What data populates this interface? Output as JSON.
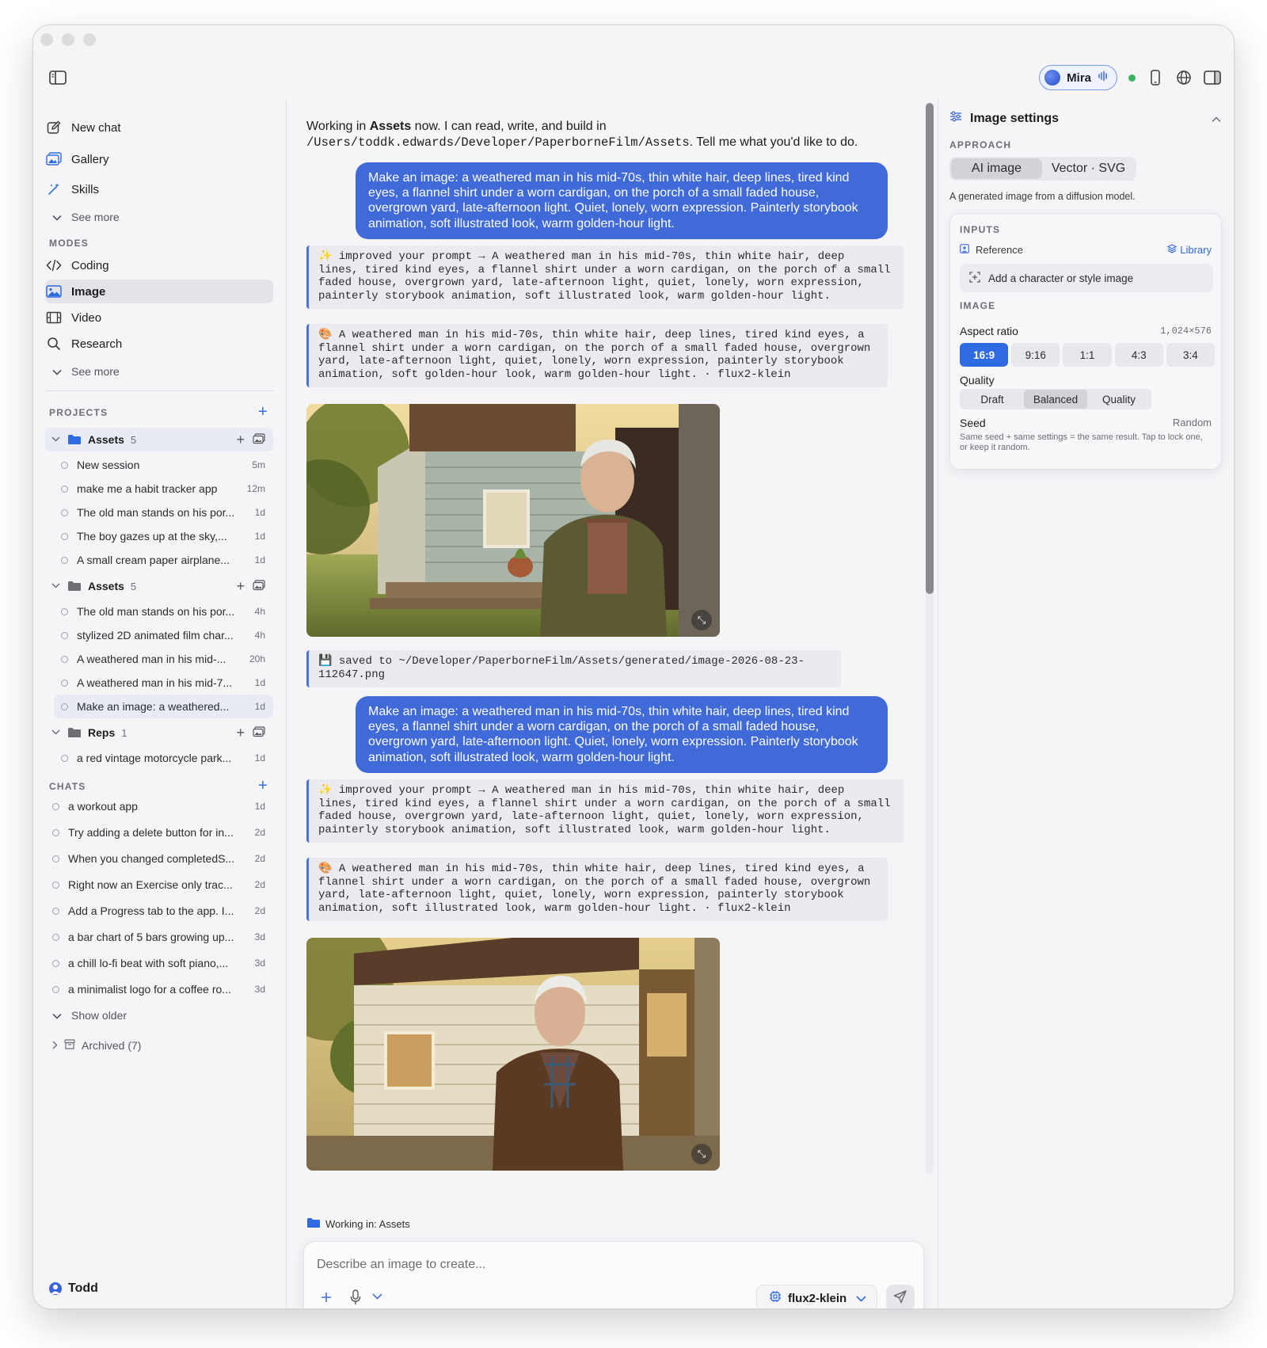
{
  "titlebar": {
    "assistant_name": "Mira"
  },
  "sidebar": {
    "nav": [
      {
        "label": "New chat",
        "icon": "compose-icon"
      },
      {
        "label": "Gallery",
        "icon": "gallery-icon"
      },
      {
        "label": "Skills",
        "icon": "magic-wand-icon"
      }
    ],
    "see_more_1": "See more",
    "modes_label": "MODES",
    "modes": [
      {
        "label": "Coding",
        "icon": "code-icon"
      },
      {
        "label": "Image",
        "icon": "image-icon"
      },
      {
        "label": "Video",
        "icon": "film-icon"
      },
      {
        "label": "Research",
        "icon": "search-icon"
      }
    ],
    "active_mode": "Image",
    "see_more_2": "See more",
    "projects_label": "PROJECTS",
    "projects": [
      {
        "name": "Assets",
        "count": "5",
        "sessions": [
          {
            "title": "New session",
            "age": "5m"
          },
          {
            "title": "make me a habit tracker app",
            "age": "12m"
          },
          {
            "title": "The old man stands on his por...",
            "age": "1d"
          },
          {
            "title": "The boy gazes up at the sky,...",
            "age": "1d"
          },
          {
            "title": "A small cream paper airplane...",
            "age": "1d"
          }
        ]
      },
      {
        "name": "Assets",
        "count": "5",
        "sessions": [
          {
            "title": "The old man stands on his por...",
            "age": "4h"
          },
          {
            "title": "stylized 2D animated film char...",
            "age": "4h"
          },
          {
            "title": "A weathered man in his mid-...",
            "age": "20h"
          },
          {
            "title": "A weathered man in his mid-7...",
            "age": "1d"
          },
          {
            "title": "Make an image: a weathered...",
            "age": "1d"
          }
        ]
      },
      {
        "name": "Reps",
        "count": "1",
        "sessions": [
          {
            "title": "a red vintage motorcycle park...",
            "age": "1d"
          }
        ]
      }
    ],
    "chats_label": "CHATS",
    "chats": [
      {
        "title": "a workout app",
        "age": "1d"
      },
      {
        "title": "Try adding a delete button for in...",
        "age": "2d"
      },
      {
        "title": "When you changed completedS...",
        "age": "2d"
      },
      {
        "title": "Right now an Exercise only trac...",
        "age": "2d"
      },
      {
        "title": "Add a Progress tab to the app. I...",
        "age": "2d"
      },
      {
        "title": "a bar chart of 5 bars growing up...",
        "age": "3d"
      },
      {
        "title": "a chill lo-fi beat with soft piano,...",
        "age": "3d"
      },
      {
        "title": "a minimalist logo for a coffee ro...",
        "age": "3d"
      }
    ],
    "show_older": "Show older",
    "archived": "Archived (7)",
    "user_name": "Todd"
  },
  "main": {
    "intro_pre": "Working in ",
    "intro_bold": "Assets",
    "intro_mid": " now. I can read, write, and build in ",
    "intro_path": "/Users/toddk.edwards/Developer/PaperborneFilm/Assets",
    "intro_post": ". Tell me what you'd like to do.",
    "user_message_1": "Make an image: a weathered man in his mid-70s, thin white hair, deep lines, tired kind eyes, a flannel shirt under a worn cardigan, on the porch of a small faded house, overgrown yard, late-afternoon light. Quiet, lonely, worn expression. Painterly storybook animation, soft illustrated look, warm golden-hour light.",
    "improved_1": "✨ improved your prompt → A weathered man in his mid-70s, thin white hair, deep\nlines, tired kind eyes, a flannel shirt under a worn cardigan, on the porch of a small\nfaded house, overgrown yard, late-afternoon light, quiet, lonely, worn expression,\npainterly storybook animation, soft illustrated look, warm golden-hour light.",
    "gen_1": "🎨 A weathered man in his mid-70s, thin white hair, deep lines, tired kind eyes, a\nflannel shirt under a worn cardigan, on the porch of a small faded house, overgrown\nyard, late-afternoon light, quiet, lonely, worn expression, painterly storybook\nanimation, soft golden-hour look, warm golden-hour light. · flux2-klein",
    "saved_1": "💾 saved to ~/Developer/PaperborneFilm/Assets/generated/image-2026-08-23-112647.png",
    "user_message_2": "Make an image: a weathered man in his mid-70s, thin white hair, deep lines, tired kind eyes, a flannel shirt under a worn cardigan, on the porch of a small faded house, overgrown yard, late-afternoon light. Quiet, lonely, worn expression. Painterly storybook animation, soft illustrated look, warm golden-hour light.",
    "improved_2": "✨ improved your prompt → A weathered man in his mid-70s, thin white hair, deep\nlines, tired kind eyes, a flannel shirt under a worn cardigan, on the porch of a small\nfaded house, overgrown yard, late-afternoon light, quiet, lonely, worn expression,\npainterly storybook animation, soft illustrated look, warm golden-hour light.",
    "gen_2": "🎨 A weathered man in his mid-70s, thin white hair, deep lines, tired kind eyes, a\nflannel shirt under a worn cardigan, on the porch of a small faded house, overgrown\nyard, late-afternoon light, quiet, lonely, worn expression, painterly storybook\nanimation, soft illustrated look, warm golden-hour light. · flux2-klein",
    "working_in": "Working in: Assets",
    "composer_placeholder": "Describe an image to create...",
    "model_name": "flux2-klein"
  },
  "settings": {
    "title": "Image settings",
    "approach_label": "APPROACH",
    "approach_options": [
      "AI image",
      "Vector · SVG"
    ],
    "approach_selected": "AI image",
    "approach_desc": "A generated image from a diffusion model.",
    "inputs_label": "INPUTS",
    "reference_label": "Reference",
    "library_label": "Library",
    "add_ref": "Add a character or style image",
    "image_label": "IMAGE",
    "aspect_label": "Aspect ratio",
    "aspect_dims": "1,024×576",
    "ratios": [
      "16:9",
      "9:16",
      "1:1",
      "4:3",
      "3:4"
    ],
    "ratio_selected": "16:9",
    "quality_label": "Quality",
    "quality_options": [
      "Draft",
      "Balanced",
      "Quality"
    ],
    "quality_selected": "Balanced",
    "seed_label": "Seed",
    "seed_value": "Random",
    "seed_help": "Same seed + same settings = the same result. Tap to lock one, or keep it random."
  }
}
